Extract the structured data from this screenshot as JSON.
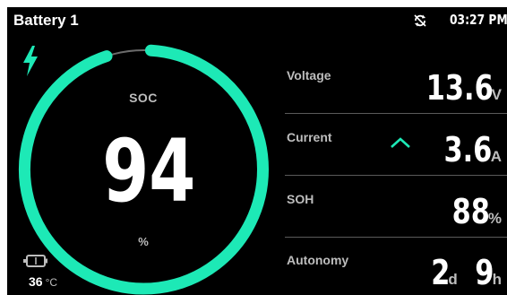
{
  "header": {
    "title": "Battery 1",
    "time": "03:27 PM"
  },
  "icons": {
    "sync": "sync-off-icon",
    "charging": "lightning-bolt-icon",
    "battery": "battery-icon",
    "trend": "chevron-up-icon"
  },
  "colors": {
    "accent": "#1de9b6",
    "background": "#000000",
    "track": "#6b6b6b"
  },
  "soc": {
    "label": "SOC",
    "value": "94",
    "unit": "%",
    "fraction": 0.94
  },
  "temperature": {
    "value": "36",
    "unit": "°C"
  },
  "metrics": {
    "voltage": {
      "label": "Voltage",
      "value": "13.6",
      "unit": "V"
    },
    "current": {
      "label": "Current",
      "value": "3.6",
      "unit": "A"
    },
    "soh": {
      "label": "SOH",
      "value": "88",
      "unit": "%"
    },
    "autonomy": {
      "label": "Autonomy",
      "days": "2",
      "days_unit": "d",
      "hours": "9",
      "hours_unit": "h"
    }
  }
}
